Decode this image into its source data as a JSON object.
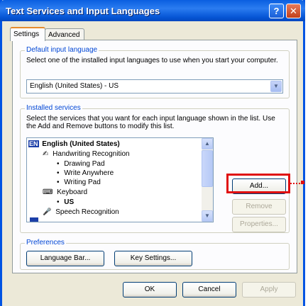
{
  "window": {
    "title": "Text Services and Input Languages",
    "help": "?",
    "close": "✕"
  },
  "tabs": [
    {
      "label": "Settings"
    },
    {
      "label": "Advanced"
    }
  ],
  "default_language": {
    "group_label": "Default input language",
    "description": "Select one of the installed input languages to use when you start your computer.",
    "selected": "English (United States) - US"
  },
  "installed_services": {
    "group_label": "Installed services",
    "description": "Select the services that you want for each input language shown in the list. Use the Add and Remove buttons to modify this list.",
    "items": {
      "language_badge": "EN",
      "language": "English (United States)",
      "handwriting": "Handwriting Recognition",
      "drawing_pad": "Drawing Pad",
      "write_anywhere": "Write Anywhere",
      "writing_pad": "Writing Pad",
      "keyboard": "Keyboard",
      "us": "US",
      "speech": "Speech Recognition"
    },
    "buttons": {
      "add": "Add...",
      "remove": "Remove",
      "properties": "Properties..."
    }
  },
  "preferences": {
    "group_label": "Preferences",
    "language_bar": "Language Bar...",
    "key_settings": "Key Settings..."
  },
  "footer": {
    "ok": "OK",
    "cancel": "Cancel",
    "apply": "Apply"
  },
  "colors": {
    "title_bar": "#0a5fe0",
    "highlight": "#e01010",
    "group_label": "#0046d5"
  }
}
